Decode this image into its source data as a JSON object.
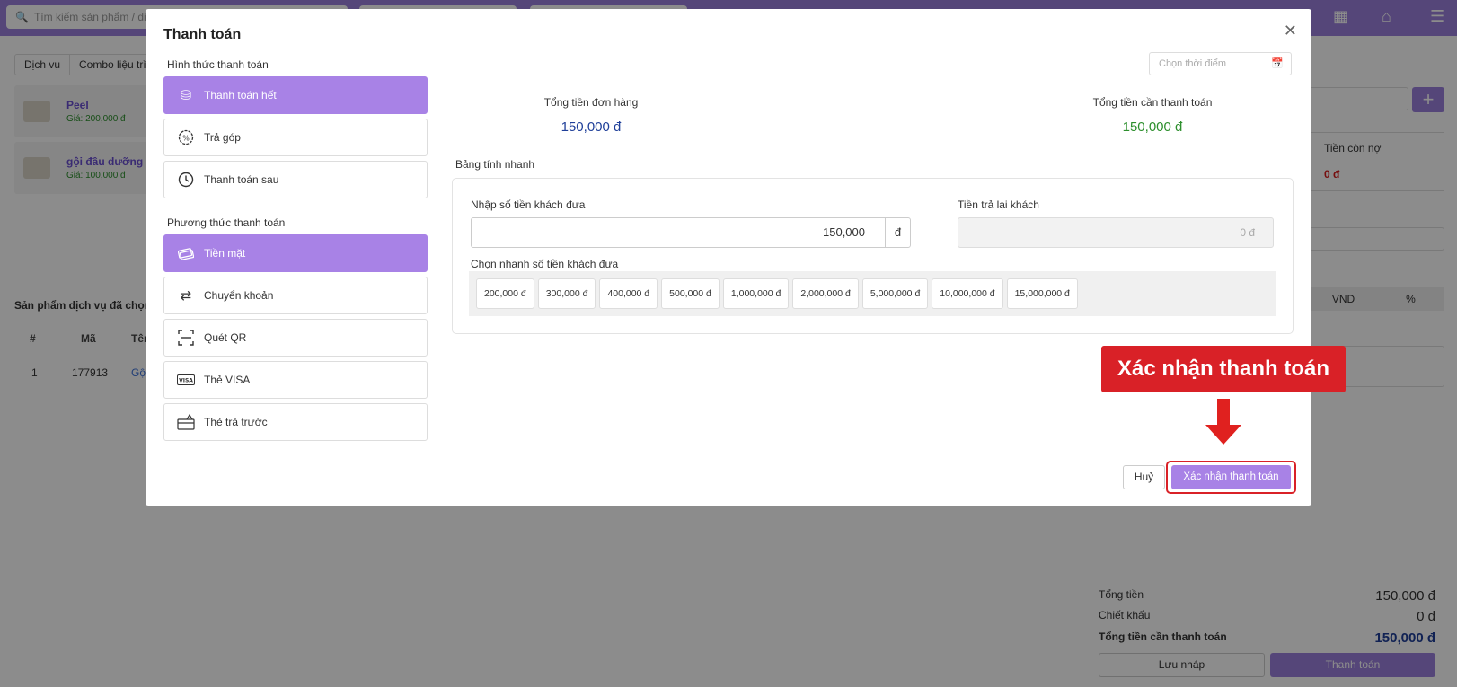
{
  "app": {
    "search_placeholder": "Tìm kiếm sản phẩm / dịch",
    "tabs": [
      "Dịch vụ",
      "Combo liệu trình"
    ],
    "services": [
      {
        "name": "Peel",
        "price": "Giá: 200,000 đ"
      },
      {
        "name": "gội đầu dưỡng",
        "price": "Giá: 100,000 đ"
      }
    ],
    "selected_title": "Sản phẩm dịch vụ đã chọn",
    "grid_headers": [
      "#",
      "Mã",
      "Tên"
    ],
    "grid_row": {
      "index": "1",
      "code": "177913",
      "name": "Gộ"
    },
    "debt_label": "Tiền còn nợ",
    "debt_value": "0 đ",
    "unit_options": [
      "VND",
      "%"
    ],
    "summary": {
      "total_label": "Tổng tiền",
      "total_value": "150,000 đ",
      "discount_label": "Chiết khấu",
      "discount_value": "0 đ",
      "due_label": "Tổng tiền cần thanh toán",
      "due_value": "150,000 đ"
    },
    "draft_button": "Lưu nháp",
    "pay_button": "Thanh toán"
  },
  "modal": {
    "title": "Thanh toán",
    "close_icon": "close-icon",
    "payment_form_title": "Hình thức thanh toán",
    "payment_forms": [
      {
        "label": "Thanh toán hết",
        "icon": "coins-icon",
        "active": true
      },
      {
        "label": "Trả góp",
        "icon": "percent-badge-icon",
        "active": false
      },
      {
        "label": "Thanh toán sau",
        "icon": "clock-icon",
        "active": false
      }
    ],
    "payment_method_title": "Phương thức thanh toán",
    "payment_methods": [
      {
        "label": "Tiền mặt",
        "icon": "cash-icon",
        "active": true
      },
      {
        "label": "Chuyển khoản",
        "icon": "transfer-icon",
        "active": false
      },
      {
        "label": "Quét QR",
        "icon": "qr-scan-icon",
        "active": false
      },
      {
        "label": "Thẻ VISA",
        "icon": "visa-card-icon",
        "active": false
      },
      {
        "label": "Thẻ trả trước",
        "icon": "prepaid-card-icon",
        "active": false
      }
    ],
    "date_placeholder": "Chọn thời điểm",
    "order_total_label": "Tổng tiền đơn hàng",
    "order_total_value": "150,000 đ",
    "due_label": "Tổng tiền cần thanh toán",
    "due_value": "150,000 đ",
    "quick_calc_title": "Bảng tính nhanh",
    "paid_label": "Nhập số tiền khách đưa",
    "paid_value": "150,000",
    "paid_unit": "đ",
    "change_label": "Tiền trả lại khách",
    "change_value": "0 đ",
    "quick_pick_label": "Chọn nhanh số tiền khách đưa",
    "quick_amounts": [
      "200,000 đ",
      "300,000 đ",
      "400,000 đ",
      "500,000 đ",
      "1,000,000 đ",
      "2,000,000 đ",
      "5,000,000 đ",
      "10,000,000 đ",
      "15,000,000 đ"
    ],
    "cancel_button": "Huỷ",
    "confirm_button": "Xác nhận thanh toán",
    "callout_text": "Xác nhận thanh toán"
  },
  "colors": {
    "accent": "#a882e6",
    "header": "#9c80dc",
    "callout": "#d92127",
    "order_total": "#1f3f99",
    "due": "#2d8f2d"
  }
}
